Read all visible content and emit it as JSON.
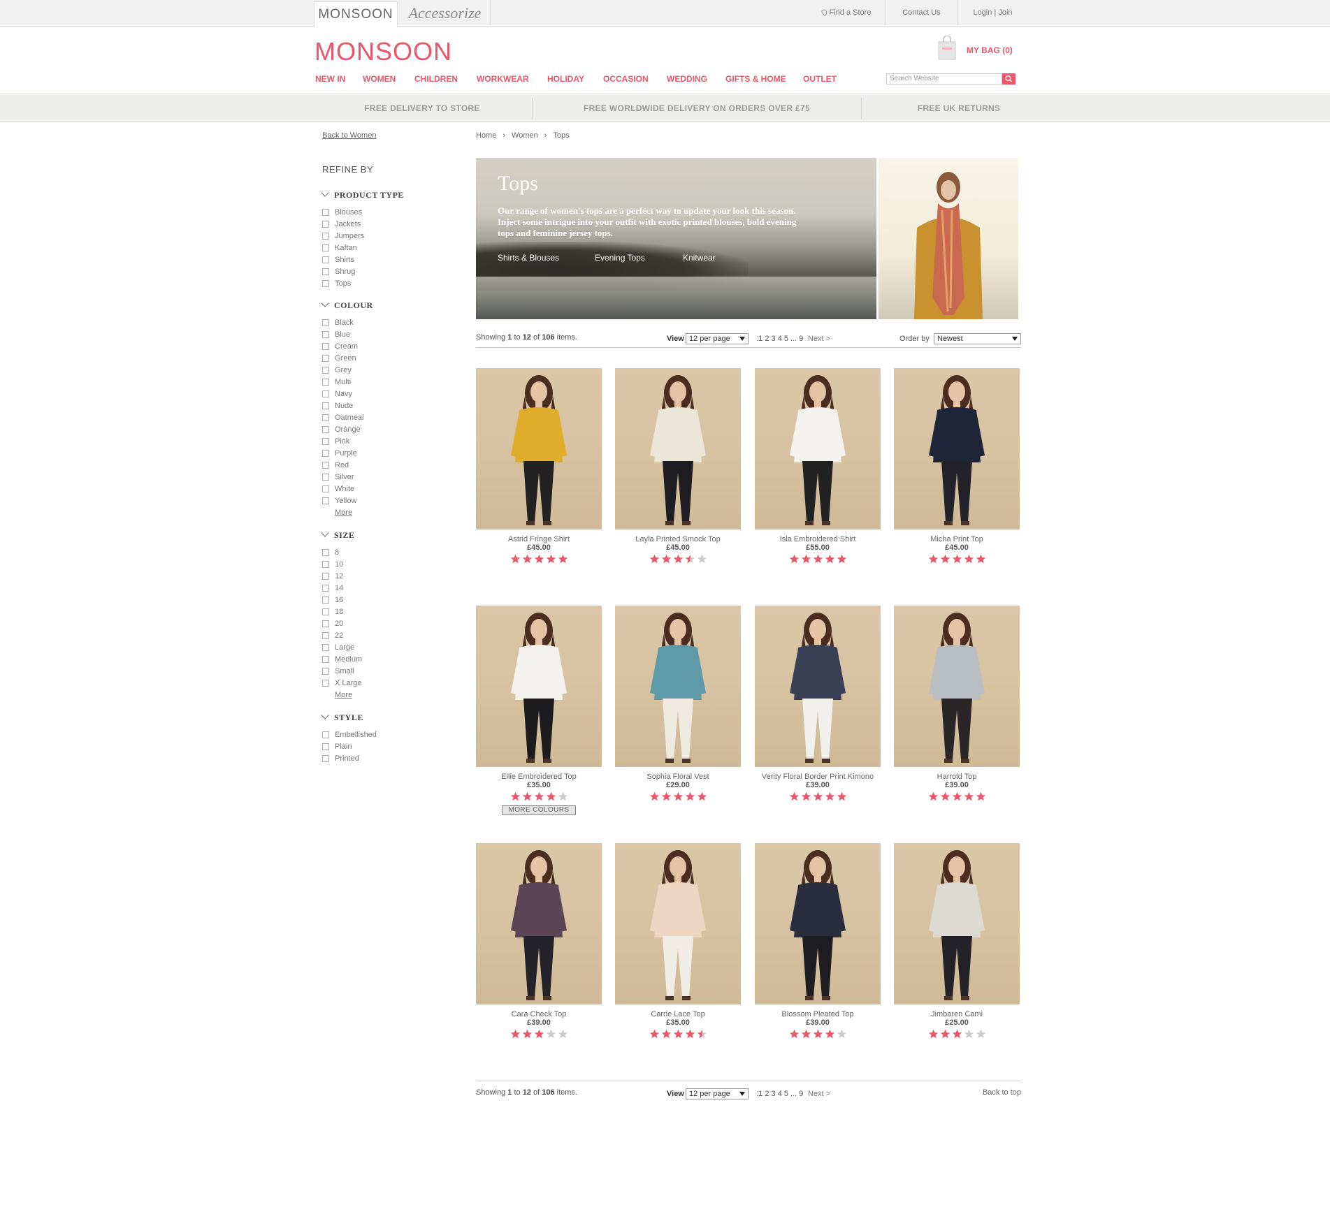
{
  "brands": {
    "monsoon": "MONSOON",
    "accessorize": "Accessorize"
  },
  "toplinks": {
    "find_store": "Find a Store",
    "contact": "Contact Us",
    "login": "Login | Join"
  },
  "header": {
    "logo": "MONSOON",
    "bag": "MY BAG (0)",
    "search_placeholder": "Search Website"
  },
  "nav": [
    "NEW IN",
    "WOMEN",
    "CHILDREN",
    "WORKWEAR",
    "HOLIDAY",
    "OCCASION",
    "WEDDING",
    "GIFTS & HOME",
    "OUTLET"
  ],
  "promo": [
    "FREE DELIVERY TO STORE",
    "FREE WORLDWIDE DELIVERY ON ORDERS OVER £75",
    "FREE UK RETURNS"
  ],
  "sidebar": {
    "back": "Back to Women",
    "refine": "REFINE BY",
    "more_label": "More",
    "groups": [
      {
        "title": "PRODUCT TYPE",
        "options": [
          "Blouses",
          "Jackets",
          "Jumpers",
          "Kaftan",
          "Shirts",
          "Shrug",
          "Tops"
        ]
      },
      {
        "title": "COLOUR",
        "options": [
          "Black",
          "Blue",
          "Cream",
          "Green",
          "Grey",
          "Multi",
          "Navy",
          "Nude",
          "Oatmeal",
          "Orange",
          "Pink",
          "Purple",
          "Red",
          "Silver",
          "White",
          "Yellow"
        ]
      },
      {
        "title": "SIZE",
        "options": [
          "8",
          "10",
          "12",
          "14",
          "16",
          "18",
          "20",
          "22",
          "Large",
          "Medium",
          "Small",
          "X Large"
        ]
      },
      {
        "title": "STYLE",
        "options": [
          "Embellished",
          "Plain",
          "Printed"
        ]
      }
    ]
  },
  "breadcrumb": [
    "Home",
    "›",
    "Women",
    "›",
    "Tops"
  ],
  "hero": {
    "title": "Tops",
    "description": "Our range of women's tops are a perfect way to update your look this season. Inject some intrigue into your outfit with exotic printed blouses, bold evening tops and feminine jersey tops.",
    "links": [
      "Shirts & Blouses",
      "Evening Tops",
      "Knitwear"
    ]
  },
  "listing": {
    "showing_prefix": "Showing ",
    "from": "1",
    "to_word": " to ",
    "to": "12",
    "of_word": " of ",
    "total": "106",
    "items_word": " items.",
    "view_label": "View",
    "per_page": "12 per page",
    "pages": "1 2 3 4 5 ... 9",
    "current_page": "1",
    "next": "Next >",
    "order_label": "Order by",
    "order_value": "Newest",
    "back_to_top": "Back to top"
  },
  "products": [
    {
      "name": "Astrid Fringe Shirt",
      "price": "£45.00",
      "rating": 5,
      "top": "#e0ad2a",
      "bottom": "#222"
    },
    {
      "name": "Layla Printed Smock Top",
      "price": "£45.00",
      "rating": 3.5,
      "top": "#ece6d8",
      "bottom": "#1e1e22"
    },
    {
      "name": "Isla Embroidered Shirt",
      "price": "£55.00",
      "rating": 5,
      "top": "#f4f2ee",
      "bottom": "#222"
    },
    {
      "name": "Micha Print Top",
      "price": "£45.00",
      "rating": 5,
      "top": "#1f2538",
      "bottom": "#22232a"
    },
    {
      "name": "Ellie Embroidered Top",
      "price": "£35.00",
      "rating": 4,
      "top": "#f3f2ee",
      "bottom": "#1c1c1e",
      "more_colours": "MORE COLOURS"
    },
    {
      "name": "Sophia Floral Vest",
      "price": "£29.00",
      "rating": 5,
      "top": "#5e9aa8",
      "bottom": "#efeae0"
    },
    {
      "name": "Verity Floral Border Print Kimono",
      "price": "£39.00",
      "rating": 5,
      "top": "#394056",
      "bottom": "#f2f0ec"
    },
    {
      "name": "Harrold Top",
      "price": "£39.00",
      "rating": 5,
      "top": "#b9bec2",
      "bottom": "#2a2628"
    },
    {
      "name": "Cara Check Top",
      "price": "£39.00",
      "rating": 3,
      "top": "#5a4456",
      "bottom": "#24232a"
    },
    {
      "name": "Carrie Lace Top",
      "price": "£35.00",
      "rating": 4.5,
      "top": "#efd6c2",
      "bottom": "#f1ede6"
    },
    {
      "name": "Blossom Pleated Top",
      "price": "£39.00",
      "rating": 4,
      "top": "#2a2d3e",
      "bottom": "#1e1e22"
    },
    {
      "name": "Jimbaren Cami",
      "price": "£25.00",
      "rating": 3,
      "top": "#dcdad2",
      "bottom": "#222228"
    }
  ],
  "colors": {
    "accent": "#e9576a",
    "star_off": "#cccccc"
  }
}
